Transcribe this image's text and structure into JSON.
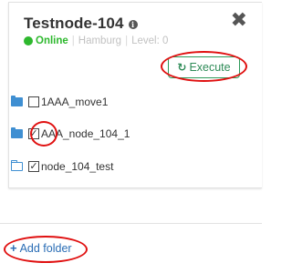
{
  "node": {
    "title": "Testnode-104",
    "info_icon": "i",
    "close_icon": "✖",
    "status": "Online",
    "location": "Hamburg",
    "level": "Level: 0"
  },
  "actions": {
    "execute_label": "Execute",
    "execute_icon": "↻"
  },
  "folders": [
    {
      "label": "1AAA_move1",
      "checked": false,
      "icon": "folder-filled-icon"
    },
    {
      "label": "AAA_node_104_1",
      "checked": true,
      "icon": "folder-filled-icon"
    },
    {
      "label": "node_104_test",
      "checked": true,
      "icon": "folder-outline-icon"
    }
  ],
  "check_mark": "✓",
  "add_folder": {
    "plus": "+",
    "label": "Add folder"
  },
  "colors": {
    "online": "#2eb82e",
    "execute": "#2e8b57",
    "folder": "#3f8fd2",
    "link": "#2a6db5",
    "annotation_ring": "#e01010"
  }
}
